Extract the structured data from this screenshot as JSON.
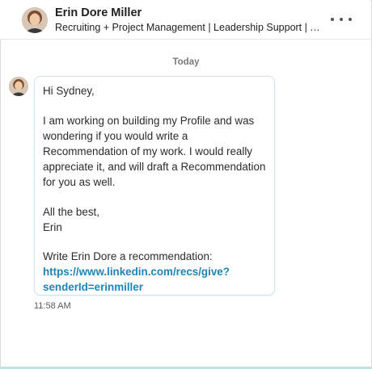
{
  "conversation": {
    "contact_name": "Erin Dore Miller",
    "contact_headline": "Recruiting + Project Management | Leadership Support | Tale...",
    "more_icon": "ellipsis-horizontal-icon"
  },
  "thread": {
    "date_label": "Today",
    "message": {
      "greeting": "Hi Sydney,",
      "body": "I am working on building my Profile and was wondering if you would write a Recommendation of my work. I would really appreciate it, and will draft a Recommendation for you as well.",
      "signoff": "All the best,",
      "signature": "Erin",
      "cta_text": "Write Erin Dore a recommendation:",
      "link_line1": "https://www.linkedin.com/recs/give?",
      "link_line2": "senderId=erinmiller",
      "time": "11:58 AM"
    }
  },
  "colors": {
    "link": "#1f84b8",
    "bubble_border": "#cfe1ef"
  }
}
